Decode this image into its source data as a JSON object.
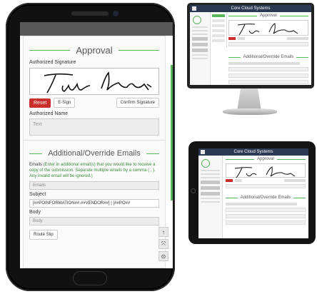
{
  "mobile": {
    "section_title": "Approval",
    "authorized_signature_label": "Authorized Signature",
    "buttons": {
      "reset": "Reset",
      "esign": "E-Sign",
      "confirm": "Confirm Signature"
    },
    "authorized_name_label": "Authorized Name",
    "authorized_name_placeholder": "Text",
    "emails_section_title": "Additional/Override Emails",
    "emails_label": "Emails",
    "emails_help": "(Enter in additional email(s) that you would like to receive a copy of the submission. Separate multiple emails by a comma ( , ). Any invalid email will be ignored.)",
    "emails_placeholder": "Emails",
    "subject_label": "Subject",
    "subject_value": "[##POINFORMATION##.##VENDOR##] | [##PO##",
    "body_label": "Body",
    "body_placeholder": "Body",
    "route_slip": "Route Slip",
    "side_icons": [
      "arrow-up-icon",
      "pdf-icon",
      "gear-icon"
    ]
  },
  "monitor": {
    "app_title": "Core Cloud Systems",
    "section_title": "Approval",
    "emails_section_title": "Additional/Override Emails"
  },
  "tablet": {
    "app_title": "Core Cloud Systems",
    "section_title": "Approval",
    "emails_section_title": "Additional/Override Emails"
  },
  "colors": {
    "accent_green": "#59b65a",
    "reset_red": "#c9302c",
    "header_dark": "#2b3a52"
  }
}
